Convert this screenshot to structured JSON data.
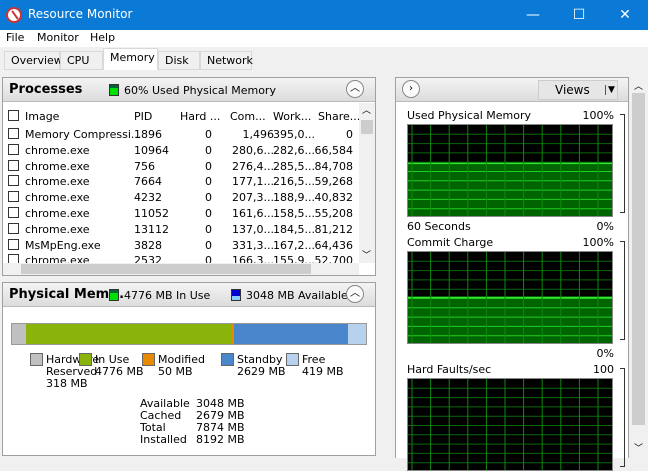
{
  "window": {
    "title": "Resource Monitor",
    "minimize": "—",
    "maximize": "☐",
    "close": "✕"
  },
  "menu": [
    "File",
    "Monitor",
    "Help"
  ],
  "tabs": [
    "Overview",
    "CPU",
    "Memory",
    "Disk",
    "Network"
  ],
  "active_tab": "Memory",
  "processes": {
    "title": "Processes",
    "status": "60% Used Physical Memory",
    "status_color": "#00e000",
    "columns": [
      "Image",
      "PID",
      "Hard ...",
      "Com...",
      "Work...",
      "Share..."
    ],
    "rows": [
      [
        "Memory Compressi...",
        "1896",
        "0",
        "1,496",
        "395,0...",
        "0"
      ],
      [
        "chrome.exe",
        "10964",
        "0",
        "280,6...",
        "282,6...",
        "66,584"
      ],
      [
        "chrome.exe",
        "756",
        "0",
        "276,4...",
        "285,5...",
        "84,708"
      ],
      [
        "chrome.exe",
        "7664",
        "0",
        "177,1...",
        "216,5...",
        "59,268"
      ],
      [
        "chrome.exe",
        "4232",
        "0",
        "207,3...",
        "188,9...",
        "40,832"
      ],
      [
        "chrome.exe",
        "11052",
        "0",
        "161,6...",
        "158,5...",
        "55,208"
      ],
      [
        "chrome.exe",
        "13112",
        "0",
        "137,0...",
        "184,5...",
        "81,212"
      ],
      [
        "MsMpEng.exe",
        "3828",
        "0",
        "331,3...",
        "167,2...",
        "64,436"
      ],
      [
        "chrome.exe",
        "2532",
        "0",
        "166,3...",
        "155,9...",
        "52,700"
      ]
    ]
  },
  "physical": {
    "title": "Physical Mem...",
    "in_use_status": "4776 MB In Use",
    "available_status": "3048 MB Available",
    "segments": [
      {
        "key": "hardware",
        "label1": "Hardware",
        "label2": "Reserved",
        "value": "318 MB",
        "mb": 318,
        "color": "#c0c0c0"
      },
      {
        "key": "inuse",
        "label1": "In Use",
        "value": "4776 MB",
        "mb": 4776,
        "color": "#8ab40c"
      },
      {
        "key": "modified",
        "label1": "Modified",
        "value": "50 MB",
        "mb": 50,
        "color": "#e88a00"
      },
      {
        "key": "standby",
        "label1": "Standby",
        "value": "2629 MB",
        "mb": 2629,
        "color": "#4a86cc"
      },
      {
        "key": "free",
        "label1": "Free",
        "value": "419 MB",
        "mb": 419,
        "color": "#b8d2ee"
      }
    ],
    "summary": [
      [
        "Available",
        "3048 MB"
      ],
      [
        "Cached",
        "2679 MB"
      ],
      [
        "Total",
        "7874 MB"
      ],
      [
        "Installed",
        "8192 MB"
      ]
    ]
  },
  "right": {
    "views_label": "Views",
    "graphs": [
      {
        "title": "Used Physical Memory",
        "max": "100%",
        "min": "0%",
        "footer": "60 Seconds",
        "value_percent": 59
      },
      {
        "title": "Commit Charge",
        "max": "100%",
        "min": "0%",
        "value_percent": 51
      },
      {
        "title": "Hard Faults/sec",
        "max": "100",
        "value_percent": 0
      }
    ]
  }
}
